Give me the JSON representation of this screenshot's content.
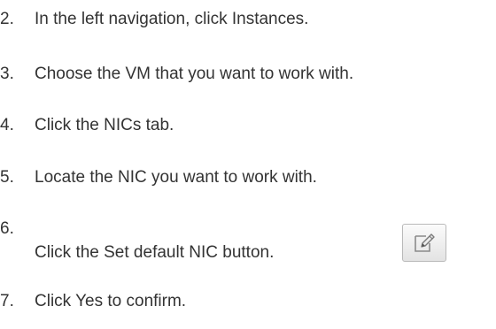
{
  "steps": [
    {
      "number": "2.",
      "text": "In the left navigation, click Instances."
    },
    {
      "number": "3.",
      "text": "Choose the VM that you want to work with."
    },
    {
      "number": "4.",
      "text": "Click the NICs tab."
    },
    {
      "number": "5.",
      "text": "Locate the NIC you want to work with."
    },
    {
      "number": "6.",
      "text": "Click the Set default NIC button."
    },
    {
      "number": "7.",
      "text": "Click Yes to confirm."
    }
  ],
  "icons": {
    "set_default_nic_button": "edit-icon"
  }
}
